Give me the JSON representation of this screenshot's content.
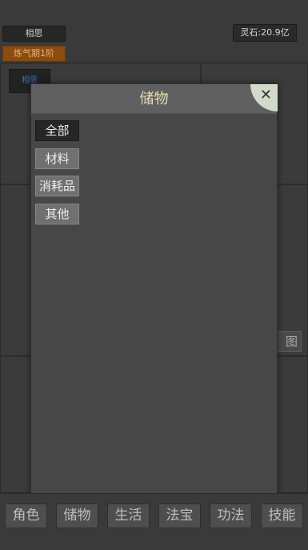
{
  "header": {
    "player_name": "相思",
    "realm": "炼气期1阶",
    "spirit_stone": "灵石:20.9亿"
  },
  "background": {
    "chip_label": "相思",
    "map_button": "图"
  },
  "modal": {
    "title": "储物",
    "close_glyph": "✕",
    "tabs": [
      {
        "label": "全部",
        "active": true
      },
      {
        "label": "材料",
        "active": false
      },
      {
        "label": "消耗品",
        "active": false
      },
      {
        "label": "其他",
        "active": false
      }
    ]
  },
  "bottom_nav": {
    "items": [
      "角色",
      "储物",
      "生活",
      "法宝",
      "功法",
      "技能"
    ]
  },
  "colors": {
    "realm_badge": "#8a4d0f",
    "modal_title": "#e6dfb0",
    "close_button_bg": "#d2dbc9",
    "active_tab": "#262626",
    "inactive_tab": "#707070"
  }
}
